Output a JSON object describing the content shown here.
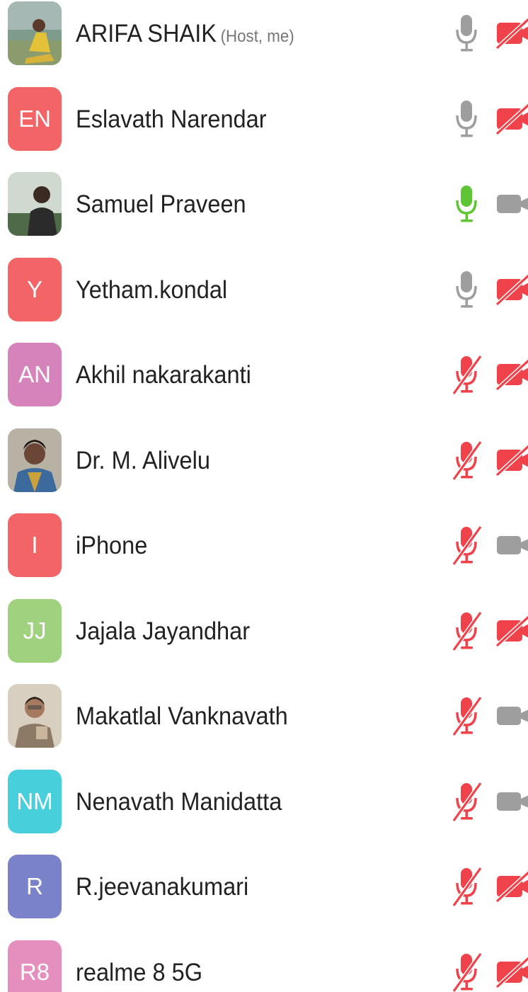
{
  "participants": [
    {
      "name": "ARIFA SHAIK",
      "role": "(Host, me)",
      "avatar_type": "photo",
      "avatar_initials": "",
      "avatar_color": "#8fae9a",
      "mic": "on",
      "camera": "off"
    },
    {
      "name": "Eslavath Narendar",
      "role": "",
      "avatar_type": "initials",
      "avatar_initials": "EN",
      "avatar_color": "#f26466",
      "mic": "on",
      "camera": "off"
    },
    {
      "name": "Samuel Praveen",
      "role": "",
      "avatar_type": "photo",
      "avatar_initials": "",
      "avatar_color": "#6f8a6c",
      "mic": "speaking",
      "camera": "on"
    },
    {
      "name": "Yetham.kondal",
      "role": "",
      "avatar_type": "initials",
      "avatar_initials": "Y",
      "avatar_color": "#f26466",
      "mic": "on",
      "camera": "off"
    },
    {
      "name": "Akhil nakarakanti",
      "role": "",
      "avatar_type": "initials",
      "avatar_initials": "AN",
      "avatar_color": "#d783bb",
      "mic": "muted",
      "camera": "off"
    },
    {
      "name": "Dr. M. Alivelu",
      "role": "",
      "avatar_type": "photo",
      "avatar_initials": "",
      "avatar_color": "#9a7f6a",
      "mic": "muted",
      "camera": "off"
    },
    {
      "name": "iPhone",
      "role": "",
      "avatar_type": "initials",
      "avatar_initials": "I",
      "avatar_color": "#f26466",
      "mic": "muted",
      "camera": "on"
    },
    {
      "name": "Jajala Jayandhar",
      "role": "",
      "avatar_type": "initials",
      "avatar_initials": "JJ",
      "avatar_color": "#9fd17f",
      "mic": "muted",
      "camera": "off"
    },
    {
      "name": "Makatlal Vanknavath",
      "role": "",
      "avatar_type": "photo",
      "avatar_initials": "",
      "avatar_color": "#b8a48f",
      "mic": "muted",
      "camera": "on"
    },
    {
      "name": "Nenavath Manidatta",
      "role": "",
      "avatar_type": "initials",
      "avatar_initials": "NM",
      "avatar_color": "#47cfdc",
      "mic": "muted",
      "camera": "on"
    },
    {
      "name": "R.jeevanakumari",
      "role": "",
      "avatar_type": "initials",
      "avatar_initials": "R",
      "avatar_color": "#7a82c9",
      "mic": "muted",
      "camera": "off"
    },
    {
      "name": "realme 8 5G",
      "role": "",
      "avatar_type": "initials",
      "avatar_initials": "R8",
      "avatar_color": "#e58fbf",
      "mic": "muted",
      "camera": "off"
    }
  ],
  "colors": {
    "mic_on": "#9e9e9e",
    "mic_speaking": "#5ec634",
    "muted_red": "#f0424a",
    "camera_on": "#9e9e9e",
    "text": "#222222",
    "role_text": "#777777"
  },
  "icons": {
    "mic": "microphone-icon",
    "mic_muted": "microphone-muted-icon",
    "camera": "video-camera-icon",
    "camera_off": "video-camera-off-icon"
  }
}
